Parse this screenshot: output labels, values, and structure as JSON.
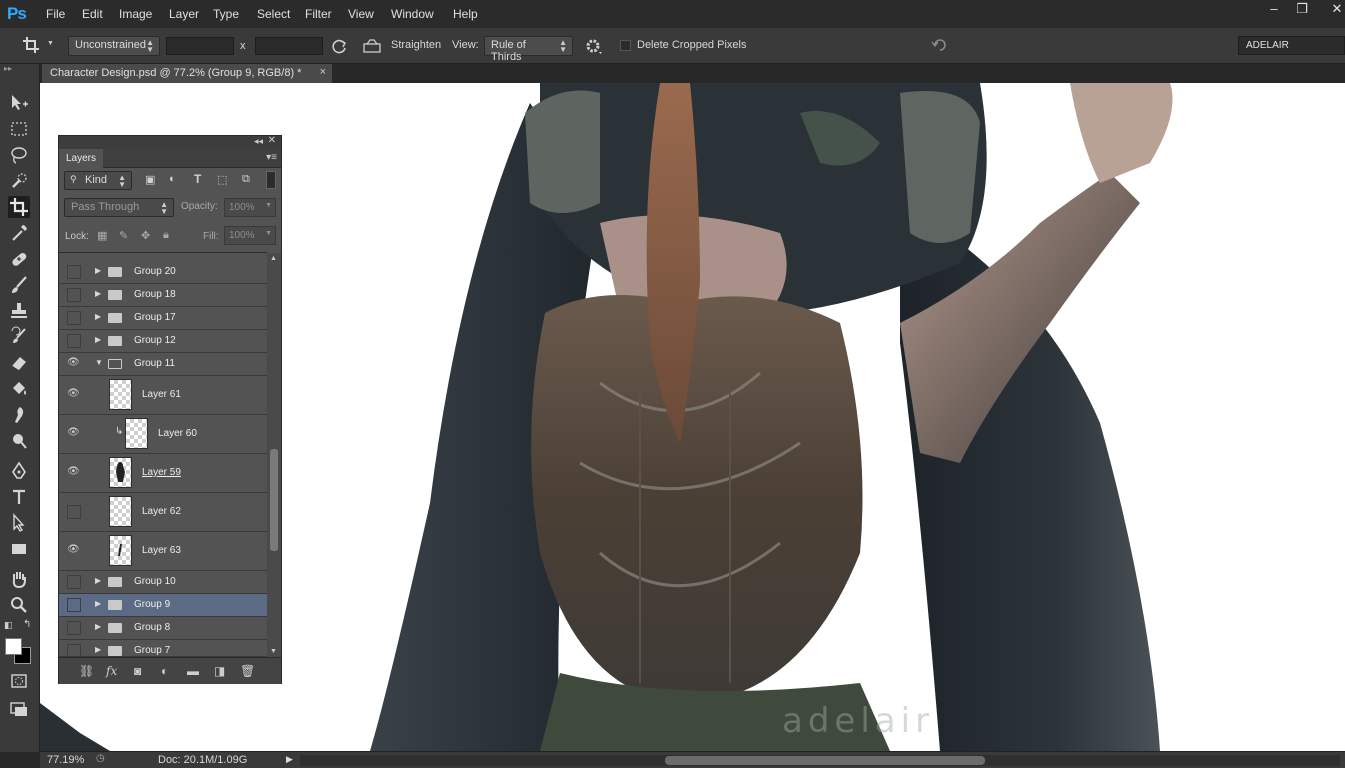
{
  "app": {
    "logo": "Ps"
  },
  "menu": [
    "File",
    "Edit",
    "Image",
    "Layer",
    "Type",
    "Select",
    "Filter",
    "View",
    "Window",
    "Help"
  ],
  "window_controls": {
    "minimize": "–",
    "restore": "❐",
    "close": "✕"
  },
  "options_bar": {
    "ratio": "Unconstrained",
    "times": "x",
    "straighten_label": "Straighten",
    "view_label": "View:",
    "view_value": "Rule of Thirds",
    "delete_cropped_label": "Delete Cropped Pixels",
    "delete_cropped_checked": false,
    "workspace": "ADELAIR"
  },
  "document": {
    "tab_title": "Character Design.psd @ 77.2% (Group 9, RGB/8) *",
    "close": "×"
  },
  "canvas": {
    "watermark": "adelair"
  },
  "status": {
    "zoom": "77.19%",
    "doc_size": "Doc: 20.1M/1.09G"
  },
  "layers_panel": {
    "tab": "Layers",
    "filter_kind": "Kind",
    "blend_mode": "Pass Through",
    "opacity_label": "Opacity:",
    "opacity_value": "100%",
    "lock_label": "Lock:",
    "fill_label": "Fill:",
    "fill_value": "100%",
    "rows": [
      {
        "name": "Group 20",
        "type": "group",
        "visible": false,
        "expanded": false,
        "selected": false
      },
      {
        "name": "Group 18",
        "type": "group",
        "visible": false,
        "expanded": false,
        "selected": false
      },
      {
        "name": "Group 17",
        "type": "group",
        "visible": false,
        "expanded": false,
        "selected": false
      },
      {
        "name": "Group 12",
        "type": "group",
        "visible": false,
        "expanded": false,
        "selected": false
      },
      {
        "name": "Group 11",
        "type": "group",
        "visible": true,
        "expanded": true,
        "selected": false
      },
      {
        "name": "Layer 61",
        "type": "layer",
        "visible": true,
        "clipped": false,
        "selected": false
      },
      {
        "name": "Layer 60",
        "type": "layer",
        "visible": true,
        "clipped": true,
        "selected": false
      },
      {
        "name": "Layer 59",
        "type": "layer",
        "visible": true,
        "clipped": false,
        "selected": false
      },
      {
        "name": "Layer 62",
        "type": "layer",
        "visible": false,
        "clipped": false,
        "selected": false
      },
      {
        "name": "Layer 63",
        "type": "layer",
        "visible": true,
        "clipped": false,
        "selected": false
      },
      {
        "name": "Group 10",
        "type": "group",
        "visible": false,
        "expanded": false,
        "selected": false
      },
      {
        "name": "Group 9",
        "type": "group",
        "visible": false,
        "expanded": false,
        "selected": true
      },
      {
        "name": "Group 8",
        "type": "group",
        "visible": false,
        "expanded": false,
        "selected": false
      },
      {
        "name": "Group 7",
        "type": "group",
        "visible": false,
        "expanded": false,
        "selected": false
      }
    ]
  }
}
